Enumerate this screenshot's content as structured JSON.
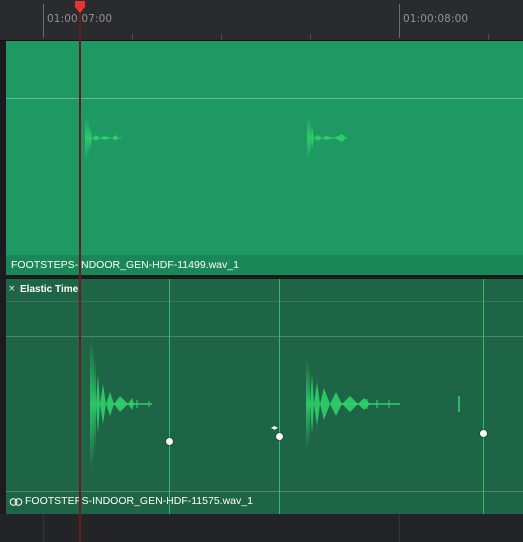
{
  "ruler": {
    "timecodes": [
      "01:00:07:00",
      "01:00:08:00"
    ]
  },
  "tracks": [
    {
      "clip_name": "FOOTSTEPS-INDOOR_GEN-HDF-11499.wav_1",
      "color": "#1f9964"
    },
    {
      "clip_name": "FOOTSTEPS-INDOOR_GEN-HDF-11575.wav_1",
      "elastic_label": "Elastic Time",
      "close_glyph": "×",
      "color": "#1e6446"
    }
  ],
  "colors": {
    "playhead": "#e8352f",
    "waveform": "#2fd06a",
    "elastic_marker": "#ffffff"
  },
  "icons": {
    "playhead": "playhead-marker-icon",
    "link": "link-icon",
    "close": "close-icon",
    "stretch": "stretch-arrows-icon"
  }
}
